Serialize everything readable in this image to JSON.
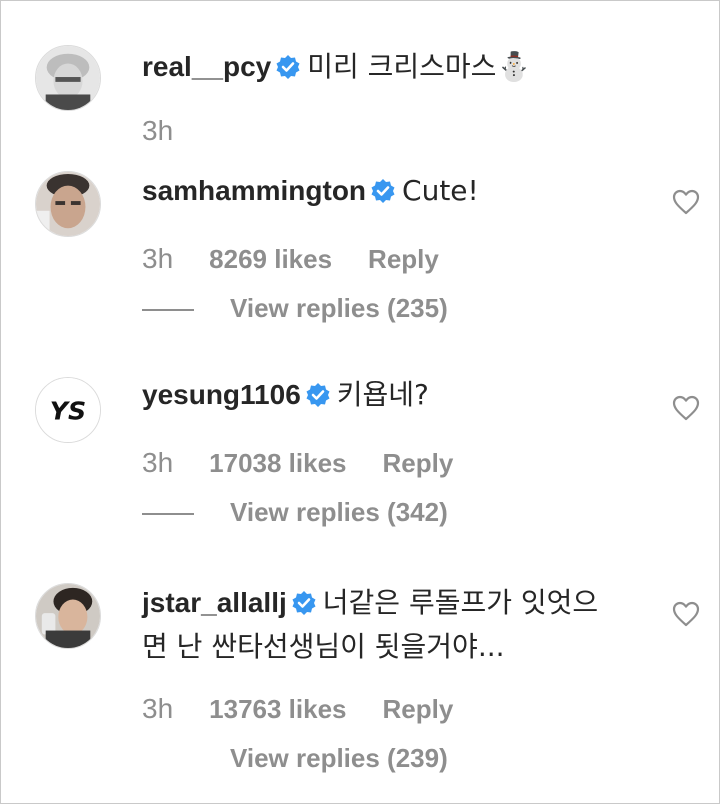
{
  "comments": [
    {
      "username": "real__pcy",
      "text": "미리 크리스마스⛄",
      "time": "3h"
    },
    {
      "username": "samhammington",
      "text": "Cute!",
      "time": "3h",
      "likes": "8269 likes",
      "reply": "Reply",
      "view_replies": "View replies (235)"
    },
    {
      "username": "yesung1106",
      "text": "키욥네?",
      "time": "3h",
      "likes": "17038 likes",
      "reply": "Reply",
      "view_replies": "View replies (342)",
      "avatar_text": "YS"
    },
    {
      "username": "jstar_allallj",
      "text_line1": "너같은 루돌프가 잇엇으",
      "text_line2": "면 난 싼타선생님이 됫을거야...",
      "time": "3h",
      "likes": "13763 likes",
      "reply": "Reply",
      "view_replies": "View replies (239)"
    }
  ],
  "icons": {
    "verified": "verified-badge-icon",
    "like": "heart-outline-icon"
  },
  "colors": {
    "verified_blue": "#3897f0",
    "muted": "#8e8e8e",
    "text": "#262626"
  }
}
